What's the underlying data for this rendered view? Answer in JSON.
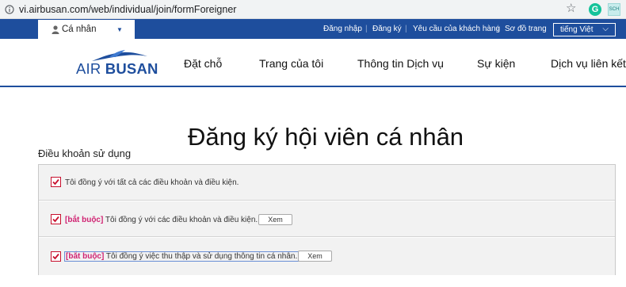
{
  "browser": {
    "url": "vi.airbusan.com/web/individual/join/formForeigner",
    "star_icon": "star-icon",
    "extension_badge": "G",
    "extension2_label": "SCH"
  },
  "topbar": {
    "member_tab_label": "Cá nhân",
    "links": [
      "Đăng nhập",
      "Đăng ký",
      "Yêu cầu của khách hàng",
      "Sơ đồ trang"
    ],
    "language": "tiếng Việt",
    "colors": {
      "brand_blue": "#1e4e9d",
      "required_pink": "#d02372",
      "checkbox_red": "#c8102e"
    }
  },
  "logo": {
    "part1": "AIR ",
    "part2": "BUSAN"
  },
  "nav": {
    "items": [
      "Đặt chỗ",
      "Trang của tôi",
      "Thông tin Dịch vụ",
      "Sự kiện",
      "Dịch vụ liên kết"
    ]
  },
  "page": {
    "title": "Đăng ký hội viên cá nhân",
    "terms_heading": "Điều khoản sử dụng"
  },
  "terms": {
    "rows": [
      {
        "checked": true,
        "required_tag": "",
        "text": "Tôi đồng ý với tất cả các điều khoản và điều kiện.",
        "button": ""
      },
      {
        "checked": true,
        "required_tag": "[bắt buộc]",
        "text": " Tôi đồng ý với các điều khoản và điều kiện.",
        "button": "Xem"
      },
      {
        "checked": true,
        "required_tag": "[bắt buộc]",
        "text": " Tôi đồng ý việc thu thập và sử dụng thông tin cá nhân.",
        "button": "Xem"
      }
    ]
  }
}
